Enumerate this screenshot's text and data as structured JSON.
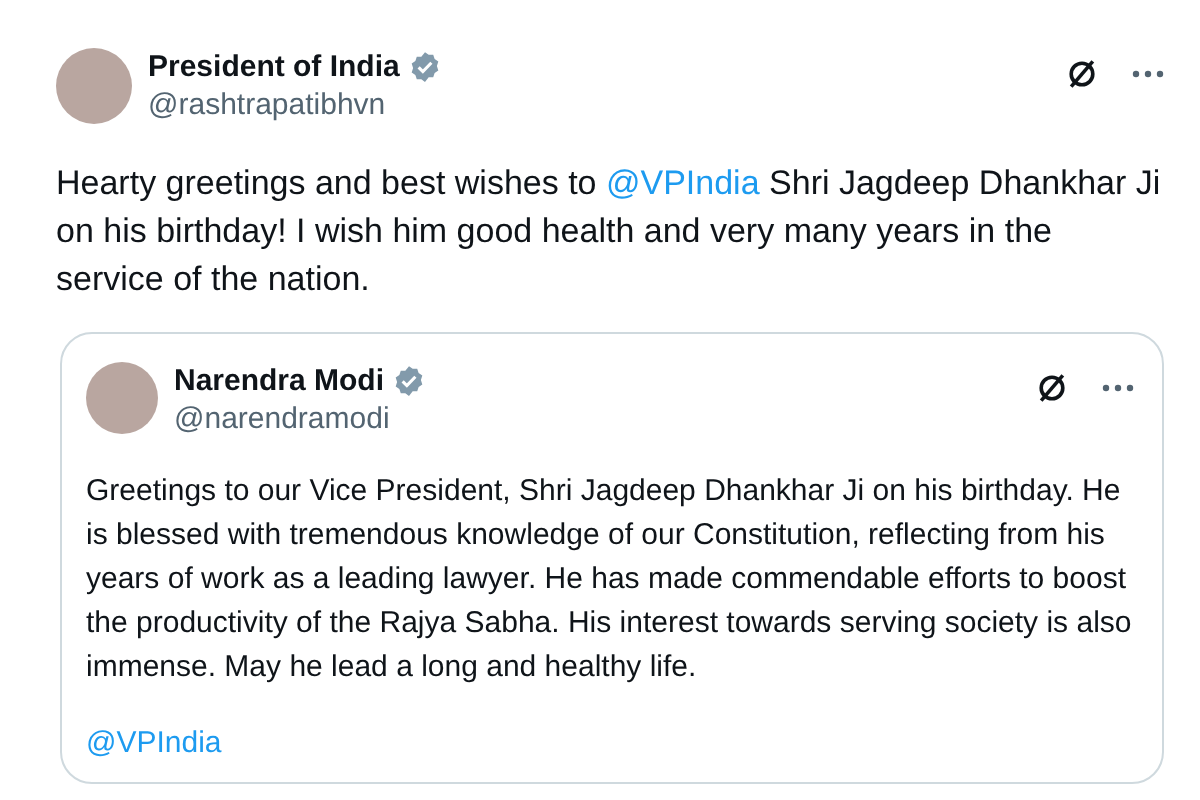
{
  "post": {
    "author": {
      "name": "President of India",
      "handle": "@rashtrapatibhvn",
      "verified": true
    },
    "text_parts": [
      {
        "kind": "text",
        "text": "Hearty greetings and best wishes to "
      },
      {
        "kind": "mention",
        "text": "@VPIndia"
      },
      {
        "kind": "text",
        "text": " Shri Jagdeep Dhankhar Ji on his birthday! I wish him good health and very many years in the service of the nation."
      }
    ],
    "quoted": {
      "author": {
        "name": "Narendra Modi",
        "handle": "@narendramodi",
        "verified": true
      },
      "paragraphs": [
        [
          {
            "kind": "text",
            "text": "Greetings to our Vice President, Shri Jagdeep Dhankhar Ji on his birthday. He is blessed with tremendous knowledge of our Constitution, reflecting from his years of work as a leading lawyer. He has made commendable efforts to boost the productivity of the Rajya Sabha. His interest towards serving society is also immense. May he lead a long and healthy life."
          }
        ],
        [
          {
            "kind": "mention",
            "text": "@VPIndia"
          }
        ]
      ]
    }
  }
}
